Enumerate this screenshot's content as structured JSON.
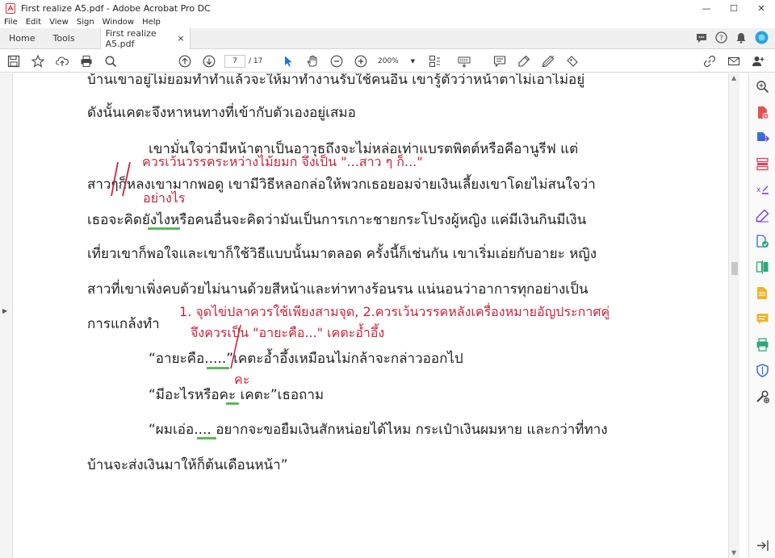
{
  "window": {
    "title": "First realize A5.pdf - Adobe Acrobat Pro DC",
    "minimize": "—",
    "maximize": "☐",
    "close": "✕"
  },
  "menu": [
    "File",
    "Edit",
    "View",
    "Sign",
    "Window",
    "Help"
  ],
  "tabs": {
    "home": "Home",
    "tools": "Tools",
    "document": "First realize A5.pdf",
    "close": "×"
  },
  "toolbar": {
    "current_page": "7",
    "total_pages": "/ 17",
    "zoom": "200%"
  },
  "document": {
    "lines": [
      "บ้านเขาอยู่ไม่ยอมทำทำแล้วจะให้มาทำงานรับใช้คนอื่น เขารู้ตัวว่าหน้าตาไม่เอาไม่อยู่",
      "ดังนั้นเคตะจึงหาหนทางที่เข้ากับตัวเองอยู่เสมอ",
      "เขามั่นใจว่ามีหน้าตาเป็นอาวุธถึงจะไม่หล่อเท่าแบรตพิตต์หรือคีอานูรีฟ  แต่",
      "สาวๆก็หลงเขามากพอดู  เขามีวิธีหลอกล่อให้พวกเธอยอมจ่ายเงินเลี้ยงเขาโดยไม่สนใจว่า",
      "เธอจะคิดยังไงหรือคนอื่นจะคิดว่ามันเป็นการเกาะชายกระโปรงผู้หญิง  แค่มีเงินกินมีเงิน",
      "เที่ยวเขาก็พอใจและเขาก็ใช้วิธีแบบนั้นมาตลอด ครั้งนี้ก็เช่นกัน เขาเริ่มเอ่ยกับอายะ หญิง",
      "สาวที่เขาเพิ่งคบด้วยไม่นานด้วยสีหน้าและท่าทางร้อนรน แน่นอนว่าอาการทุกอย่างเป็น",
      "การแกล้งทำ",
      "“อายะคือ.....”เคตะอ้ำอึ้งเหมือนไม่กล้าจะกล่าวออกไป",
      "“มีอะไรหรือคะ เคตะ”เธอถาม",
      "“ผมเอ่อ.... อยากจะขอยืมเงินสักหน่อยได้ไหม กระเป๋าเงินผมหาย และกว่าที่ทาง",
      "บ้านจะส่งเงินมาให้ก็ต้นเดือนหน้า”"
    ],
    "annotations": {
      "spacing_note": "ควรเว้นวรรคระหว่างไม้ยมก จึงเป็น \"...สาว ๆ ก็...\"",
      "word_fix": "อย่างไร",
      "ellipsis_note_1": "1. จุดไข่ปลาควรใช้เพียงสามจุด, 2.ควรเว้นวรรคหลังเครื่องหมายอัญประกาศคู่",
      "ellipsis_note_2": "จึงควรเป็น \"อายะคือ...\" เคตะอ้ำอึ้ง",
      "kha_fix": "คะ"
    }
  },
  "colors": {
    "annotation": "#c8243a",
    "highlight": "#5cb85c",
    "acrobat_accent": "#d7373f"
  }
}
